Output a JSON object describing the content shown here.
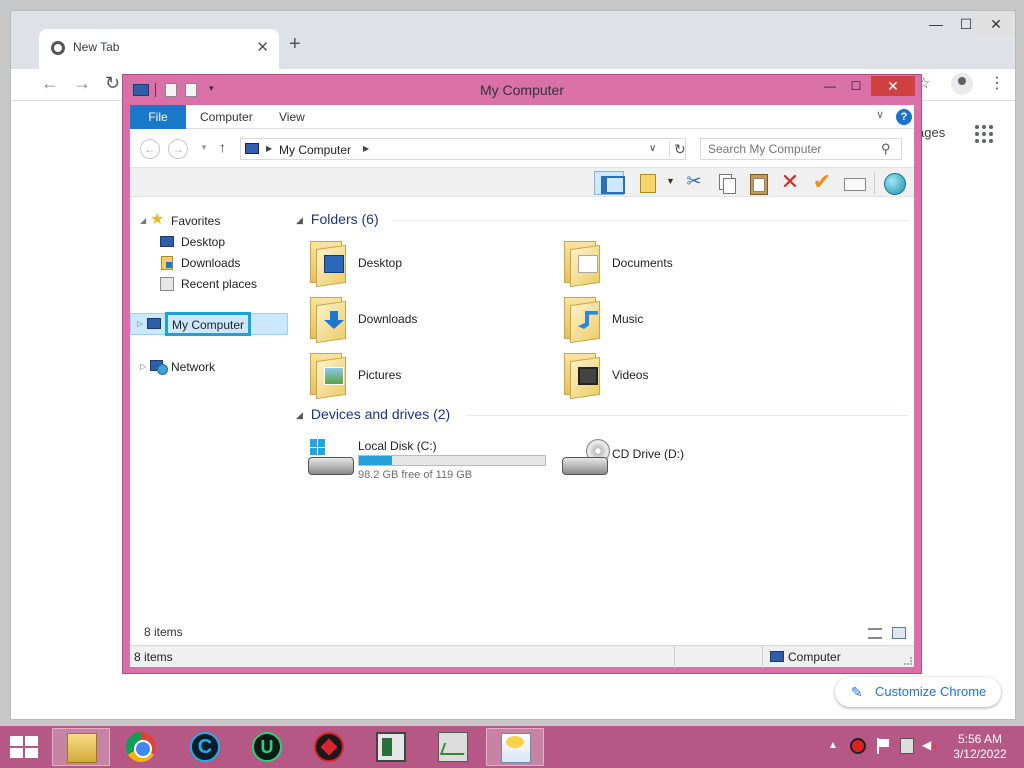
{
  "chrome": {
    "tab_title": "New Tab",
    "images_link": "ages",
    "customize_label": "Customize Chrome"
  },
  "explorer": {
    "title": "My Computer",
    "ribbon_tabs": [
      "File",
      "Computer",
      "View"
    ],
    "address": {
      "crumb": "My Computer"
    },
    "search": {
      "placeholder": "Search My Computer"
    },
    "nav": {
      "favorites": "Favorites",
      "items": [
        "Desktop",
        "Downloads",
        "Recent places"
      ],
      "my_computer": "My Computer",
      "network": "Network"
    },
    "groups": {
      "folders_header": "Folders (6)",
      "devices_header": "Devices and drives (2)"
    },
    "folders": [
      "Desktop",
      "Documents",
      "Downloads",
      "Music",
      "Pictures",
      "Videos"
    ],
    "drives": {
      "c": {
        "name": "Local Disk (C:)",
        "capacity": "98.2 GB free of 119 GB",
        "used_fraction": 0.175
      },
      "d": {
        "name": "CD Drive (D:)"
      }
    },
    "status_inner": "8 items",
    "statusbar": {
      "left": "8 items",
      "zone": "Computer"
    }
  },
  "taskbar": {
    "clock_time": "5:56 AM",
    "clock_date": "3/12/2022"
  },
  "colors": {
    "explorer_frame": "#d970a8",
    "taskbar": "#b55886",
    "accent": "#1979ca",
    "progress": "#26a0da",
    "close_button": "#d04040"
  }
}
